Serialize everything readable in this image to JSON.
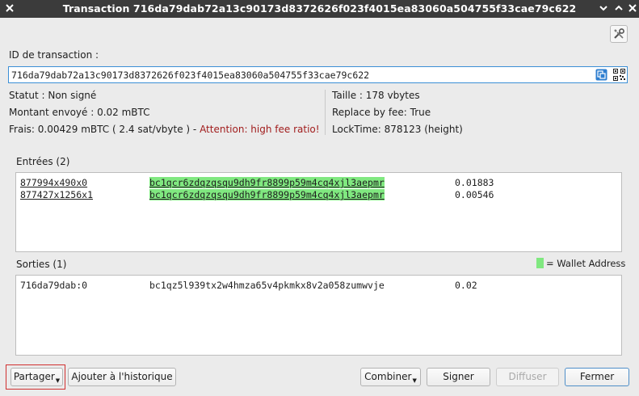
{
  "window": {
    "title": "Transaction 716da79dab72a13c90173d8372626f023f4015ea83060a504755f33cae79c622"
  },
  "txid": {
    "label": "ID de transaction :",
    "value": "716da79dab72a13c90173d8372626f023f4015ea83060a504755f33cae79c622"
  },
  "info_left": {
    "status": "Statut : Non signé",
    "amount": "Montant envoyé : 0.02 mBTC",
    "fee_prefix": "Frais: 0.00429 mBTC ( 2.4 sat/vbyte ) - ",
    "fee_warning": "Attention: high fee ratio!"
  },
  "info_right": {
    "size": "Taille : 178 vbytes",
    "rbf": "Replace by fee: True",
    "locktime": "LockTime: 878123 (height)"
  },
  "inputs": {
    "header": "Entrées (2)",
    "rows": [
      {
        "outpoint": "877994x490x0",
        "address": "bc1qcr6zdqzqsqu9dh9fr8899p59m4cq4xjl3aepmr",
        "amount": "0.01883"
      },
      {
        "outpoint": "877427x1256x1",
        "address": "bc1qcr6zdqzqsqu9dh9fr8899p59m4cq4xjl3aepmr",
        "amount": "0.00546"
      }
    ]
  },
  "outputs": {
    "header": "Sorties (1)",
    "legend": "= Wallet Address",
    "rows": [
      {
        "outpoint": "716da79dab:0",
        "address": "bc1qz5l939tx2w4hmza65v4pkmkx8v2a058zumwvje",
        "amount": "0.02"
      }
    ]
  },
  "buttons": {
    "share": "Partager",
    "add_history": "Ajouter à l'historique",
    "combine": "Combiner",
    "sign": "Signer",
    "broadcast": "Diffuser",
    "close": "Fermer"
  },
  "colors": {
    "wallet_highlight": "#80e880",
    "warning": "#a11d1d",
    "titlebar": "#3b3b3b",
    "focus_border": "#3b8fd6",
    "share_outline": "#d03030"
  },
  "icons": [
    "tools-icon",
    "copy-icon",
    "qr-code-icon",
    "close-icon",
    "minimize-icon",
    "maximize-icon"
  ]
}
